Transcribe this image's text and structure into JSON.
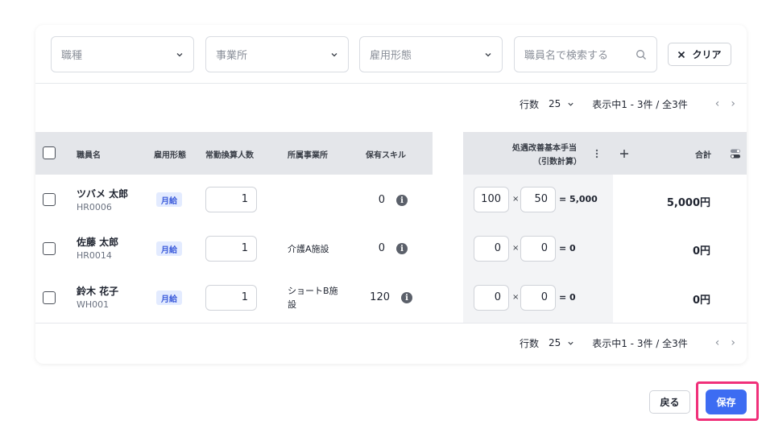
{
  "filters": {
    "job_type_placeholder": "職種",
    "office_placeholder": "事業所",
    "employment_placeholder": "雇用形態",
    "search_placeholder": "職員名で検索する",
    "clear_label": "クリア"
  },
  "pager": {
    "rows_label": "行数",
    "rows_value": "25",
    "range_text": "表示中1 - 3件 / 全3件"
  },
  "table": {
    "headers": {
      "name": "職員名",
      "employment": "雇用形態",
      "fte": "常勤換算人数",
      "office": "所属事業所",
      "skill": "保有スキル",
      "allowance_line1": "処遇改善基本手当",
      "allowance_line2": "（引数計算）",
      "total": "合計"
    },
    "rows": [
      {
        "name": "ツバメ 太郎",
        "code": "HR0006",
        "employment": "月給",
        "fte": "1",
        "office": "",
        "skill": "0",
        "a": "100",
        "b": "50",
        "result": "= 5,000",
        "total": "5,000円"
      },
      {
        "name": "佐藤 太郎",
        "code": "HR0014",
        "employment": "月給",
        "fte": "1",
        "office": "介護A施設",
        "skill": "0",
        "a": "0",
        "b": "0",
        "result": "= 0",
        "total": "0円"
      },
      {
        "name": "鈴木 花子",
        "code": "WH001",
        "employment": "月給",
        "fte": "1",
        "office_line1": "ショートB施",
        "office_line2": "設",
        "skill": "120",
        "a": "0",
        "b": "0",
        "result": "= 0",
        "total": "0円"
      }
    ]
  },
  "actions": {
    "back_label": "戻る",
    "save_label": "保存"
  },
  "icons": [
    "chevron-down-icon",
    "search-icon",
    "close-icon",
    "chevron-left-icon",
    "chevron-right-icon",
    "info-icon",
    "more-vertical-icon",
    "plus-icon",
    "toggle-icon"
  ],
  "colors": {
    "primary": "#3d6cf2",
    "highlight": "#f0307a",
    "badge_bg": "#e3ebff",
    "badge_text": "#3b5bdb"
  }
}
